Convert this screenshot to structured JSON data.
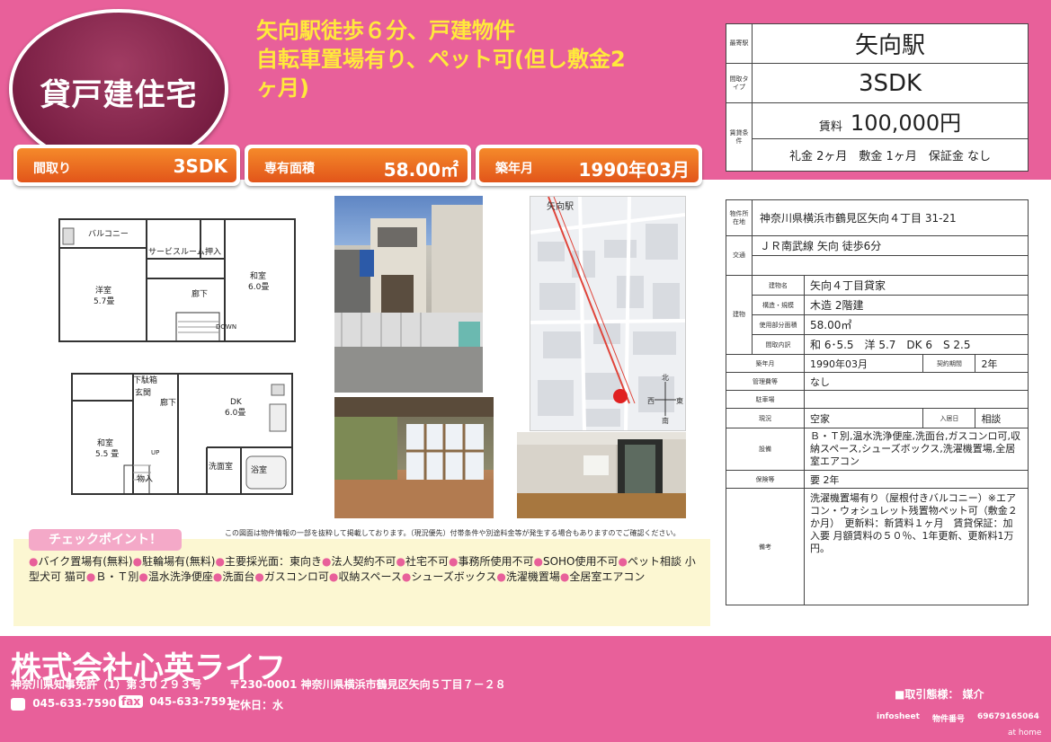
{
  "header": {
    "category": "貸戸建住宅",
    "headline_lines": [
      "矢向駅徒歩６分、戸建物件",
      "自転車置場有り、ペット可(但し敷金2",
      "ヶ月)"
    ]
  },
  "badges": [
    {
      "label": "間取り",
      "value": "3SDK"
    },
    {
      "label": "専有面積",
      "value": "58.00㎡"
    },
    {
      "label": "築年月",
      "value": "1990年03月"
    }
  ],
  "floorplan": {
    "upper": {
      "balcony": "バルコニー",
      "service_room": "サービスルーム",
      "closet": "押入",
      "western_room": "洋室",
      "western_size": "5.7畳",
      "hallway": "廊下",
      "japanese_room": "和室",
      "japanese_size": "6.0畳",
      "down": "DOWN"
    },
    "lower": {
      "shoe_box": "下駄箱",
      "entrance": "玄関",
      "hallway": "廊下",
      "dk": "DK",
      "dk_size": "6.0畳",
      "japanese_room": "和室",
      "japanese_size": "5.5 畳",
      "closet": "物入",
      "washroom": "洗面室",
      "bath": "浴室",
      "up": "UP"
    }
  },
  "map": {
    "station_label": "矢向駅",
    "compass_n": "北",
    "compass_e": "東",
    "compass_w": "西",
    "compass_s": "南"
  },
  "plan_note": "この図面は物件情報の一部を抜粋して掲載しております。（現況優先）付帯条件や別途料金等が発生する場合もありますのでご確認ください。",
  "checkpoints": {
    "title": "チェックポイント！",
    "items": [
      "バイク置場有(無料)",
      "駐輪場有(無料)",
      "主要採光面：東向き",
      "法人契約不可",
      "社宅不可",
      "事務所使用不可",
      "SOHO使用不可",
      "ペット相談 小型犬可 猫可",
      "Ｂ・Ｔ別",
      "温水洗浄便座",
      "洗面台",
      "ガスコンロ可",
      "収納スペース",
      "シューズボックス",
      "洗濯機置場",
      "全居室エアコン"
    ]
  },
  "summary": {
    "station_label": "最寄駅",
    "station": "矢向駅",
    "layout_label": "間取タイプ",
    "layout": "3SDK",
    "terms_label": "賃貸条件",
    "rent_label": "賃料",
    "rent": "100,000円",
    "deposits": "礼金 2ヶ月　敷金 1ヶ月　保証金 なし"
  },
  "details": {
    "address_label": "物件所在地",
    "address": "神奈川県横浜市鶴見区矢向４丁目 31-21",
    "transport_label": "交通",
    "transport": "ＪＲ南武線 矢向 徒歩6分",
    "building_label": "建物",
    "name_label": "建物名",
    "name": "矢向４丁目貸家",
    "structure_label": "構造・規模",
    "structure": "木造 2階建",
    "area_label": "使用部分面積",
    "area": "58.00㎡",
    "rooms_label": "間取内訳",
    "rooms": "和 6･5.5　洋 5.7　DK 6　S 2.5",
    "built_label": "築年月",
    "built": "1990年03月",
    "term_label": "契約期間",
    "term": "2年",
    "mgmt_label": "管理費等",
    "mgmt": "なし",
    "parking_label": "駐車場",
    "parking": "",
    "status_label": "現況",
    "status": "空家",
    "movein_label": "入居日",
    "movein": "相談",
    "facilities_label": "設備",
    "facilities": "Ｂ・Ｔ別,温水洗浄便座,洗面台,ガスコンロ可,収納スペース,シューズボックス,洗濯機置場,全居室エアコン",
    "insurance_label": "保険等",
    "insurance": "要 2年",
    "remarks_label": "備考",
    "remarks": "洗濯機置場有り（屋根付きバルコニー）※エアコン・ウォシュレット残置物ペット可（敷金２か月）　更新料：新賃料１ヶ月　賃貸保証：加入要 月額賃料の５０％、1年更新、更新料1万円。"
  },
  "footer": {
    "company": "株式会社心英ライフ",
    "license": "神奈川県知事免許（1）第３０２９３号",
    "address": "〒230-0001 神奈川県横浜市鶴見区矢向５丁目７－２８",
    "tel": "045-633-7590",
    "fax_label": "fax",
    "fax": "045-633-7591",
    "holiday": "定休日：水",
    "transaction": "■取引態様： 媒介",
    "infosheet": "infosheet",
    "property_no_label": "物件番号",
    "property_no": "69679165064",
    "athome": "at home"
  },
  "colors": {
    "brand_pink": "#e8609a",
    "headline_yellow": "#ffe93c",
    "badge_orange": "#e2551a",
    "check_bg": "#fcf7d2"
  }
}
